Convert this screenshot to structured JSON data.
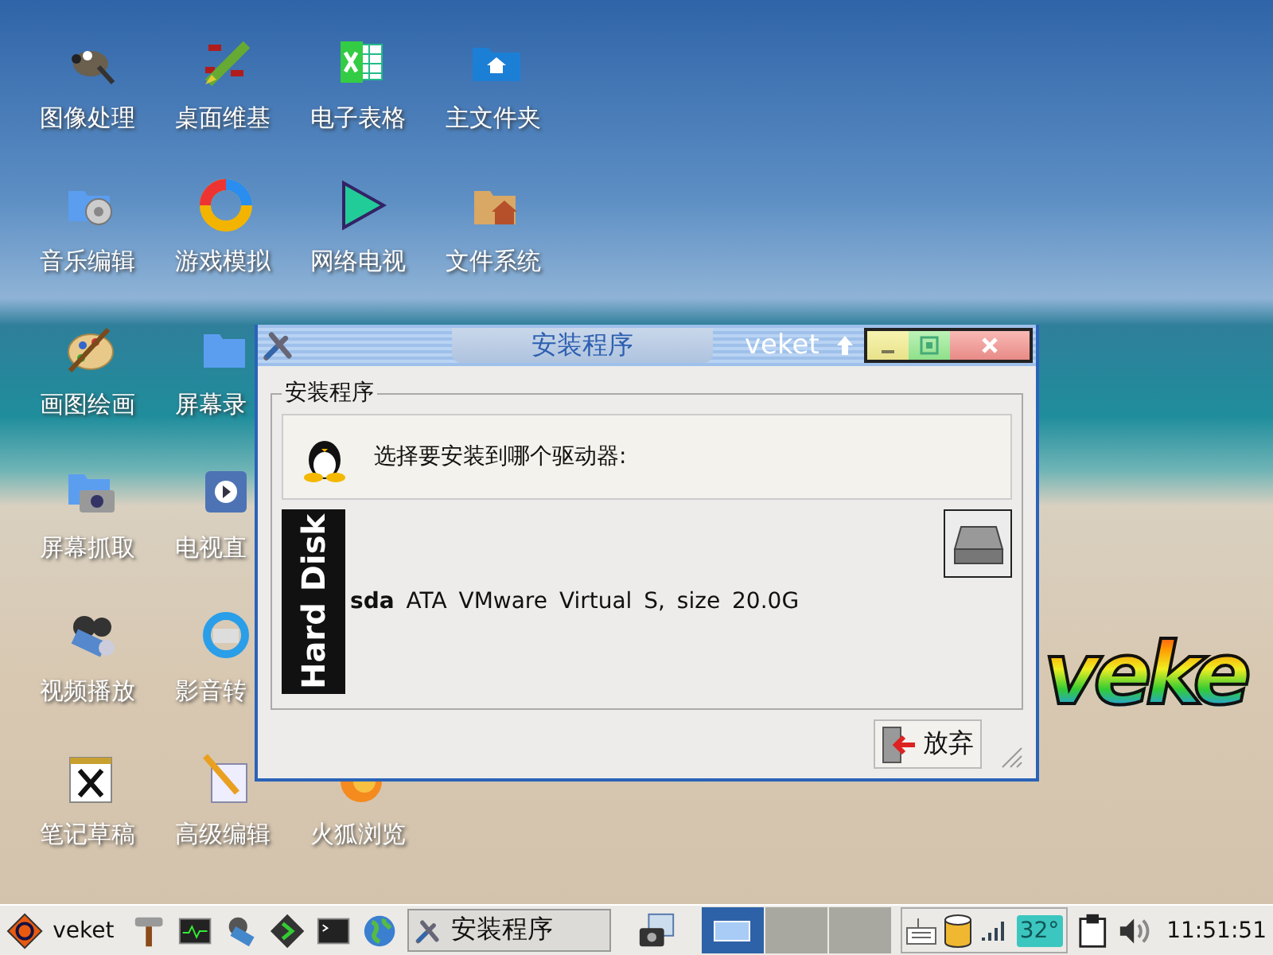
{
  "desktop": {
    "rows": [
      [
        {
          "label": "图像处理",
          "kind": "gimp"
        },
        {
          "label": "桌面维基",
          "kind": "wiki"
        },
        {
          "label": "电子表格",
          "kind": "sheet"
        },
        {
          "label": "主文件夹",
          "kind": "home"
        }
      ],
      [
        {
          "label": "音乐编辑",
          "kind": "music"
        },
        {
          "label": "游戏模拟",
          "kind": "game"
        },
        {
          "label": "网络电视",
          "kind": "play"
        },
        {
          "label": "文件系统",
          "kind": "files"
        }
      ],
      [
        {
          "label": "画图绘画",
          "kind": "paint"
        },
        {
          "label": "屏幕录",
          "kind": "record"
        }
      ],
      [
        {
          "label": "屏幕抓取",
          "kind": "camera"
        },
        {
          "label": "电视直",
          "kind": "tv"
        }
      ],
      [
        {
          "label": "视频播放",
          "kind": "video"
        },
        {
          "label": "影音转",
          "kind": "convert"
        }
      ],
      [
        {
          "label": "笔记草稿",
          "kind": "note"
        },
        {
          "label": "高级编辑",
          "kind": "edit"
        },
        {
          "label": "火狐浏览",
          "kind": "firefox"
        }
      ]
    ],
    "wallpaper_logo": "veke"
  },
  "dialog": {
    "title": "安装程序",
    "wm_label": "veket",
    "group_title": "安装程序",
    "prompt": "选择要安装到哪个驱动器:",
    "drives": [
      {
        "type_label": "Hard Disk",
        "description": "**sda** ATA VMware Virtual S, size 20.0G"
      }
    ],
    "cancel_button": "放弃"
  },
  "taskbar": {
    "start_label": "veket",
    "launchers": [
      {
        "kind": "hammer"
      },
      {
        "kind": "monitor"
      },
      {
        "kind": "media"
      },
      {
        "kind": "play"
      },
      {
        "kind": "terminal"
      },
      {
        "kind": "globe"
      }
    ],
    "tasks": [
      {
        "label": "安装程序",
        "selected": true
      }
    ],
    "workspaces": [
      {
        "selected": true
      },
      {
        "selected": false
      },
      {
        "selected": false
      }
    ],
    "temperature": "32°",
    "clock": "11:51:51"
  }
}
